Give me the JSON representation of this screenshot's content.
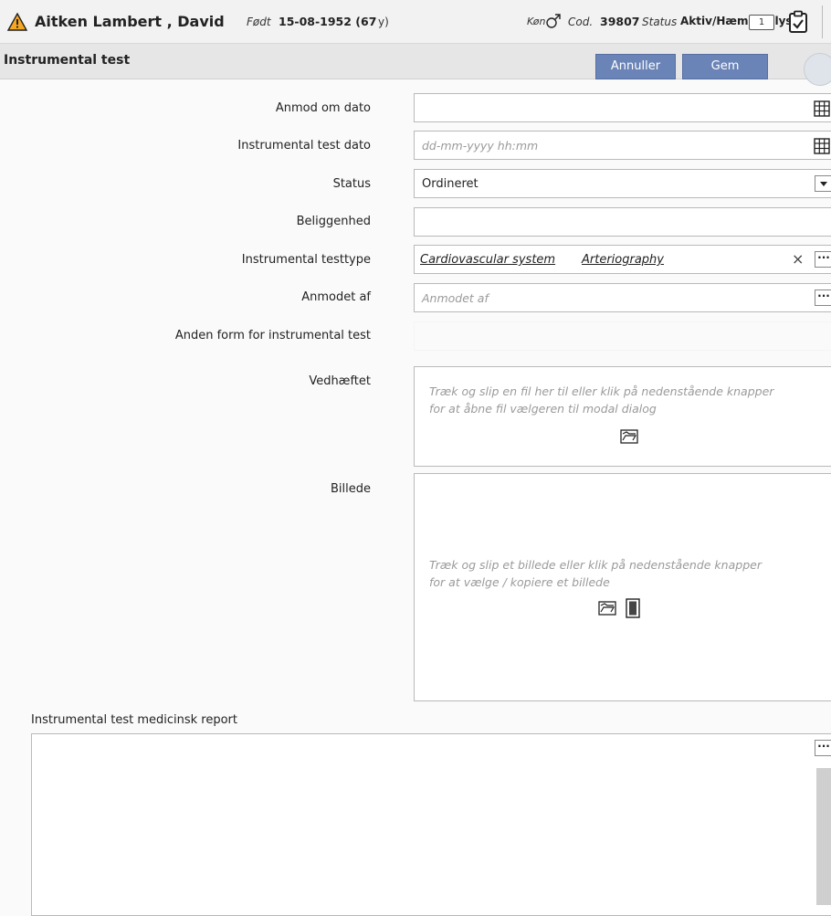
{
  "header": {
    "warning_icon": "warning-triangle-icon",
    "patient_name": "Aitken Lambert , David",
    "born_label": "Født",
    "born_value": "15-08-1952 (67",
    "age_suffix": "y)",
    "sex_label": "Køn",
    "sex_icon": "male-icon",
    "code_label": "Cod.",
    "code_value": "39807",
    "status_label": "Status",
    "status_value": "Aktiv/Hæmodialyse",
    "card_badge": "1",
    "clipboard_icon": "clipboard-check-icon"
  },
  "titlebar": {
    "title": "Instrumental test",
    "cancel_label": "Annuller",
    "save_label": "Gem"
  },
  "form": {
    "request_date": {
      "label": "Anmod om dato",
      "value": ""
    },
    "test_date": {
      "label": "Instrumental test dato",
      "placeholder": "dd-mm-yyyy hh:mm"
    },
    "status": {
      "label": "Status",
      "value": "Ordineret"
    },
    "location": {
      "label": "Beliggenhed",
      "value": ""
    },
    "test_type": {
      "label": "Instrumental testtype",
      "category": "Cardiovascular system",
      "type": "Arteriography",
      "clear": "×",
      "more": "···"
    },
    "requested_by": {
      "label": "Anmodet af",
      "placeholder": "Anmodet af",
      "more": "···"
    },
    "other_form": {
      "label": "Anden form for instrumental test"
    },
    "attachment": {
      "label": "Vedhæftet",
      "hint_line1": "Træk og slip en fil her til eller klik på nedenstående knapper",
      "hint_line2": "for at åbne fil vælgeren til modal dialog"
    },
    "image": {
      "label": "Billede",
      "hint_line1": "Træk og slip et billede eller klik på nedenstående knapper",
      "hint_line2": "for at vælge / kopiere et billede"
    },
    "report": {
      "label": "Instrumental test medicinsk report",
      "more": "···"
    }
  },
  "colors": {
    "button": "#6b84b7",
    "warning": "#f5a623"
  }
}
